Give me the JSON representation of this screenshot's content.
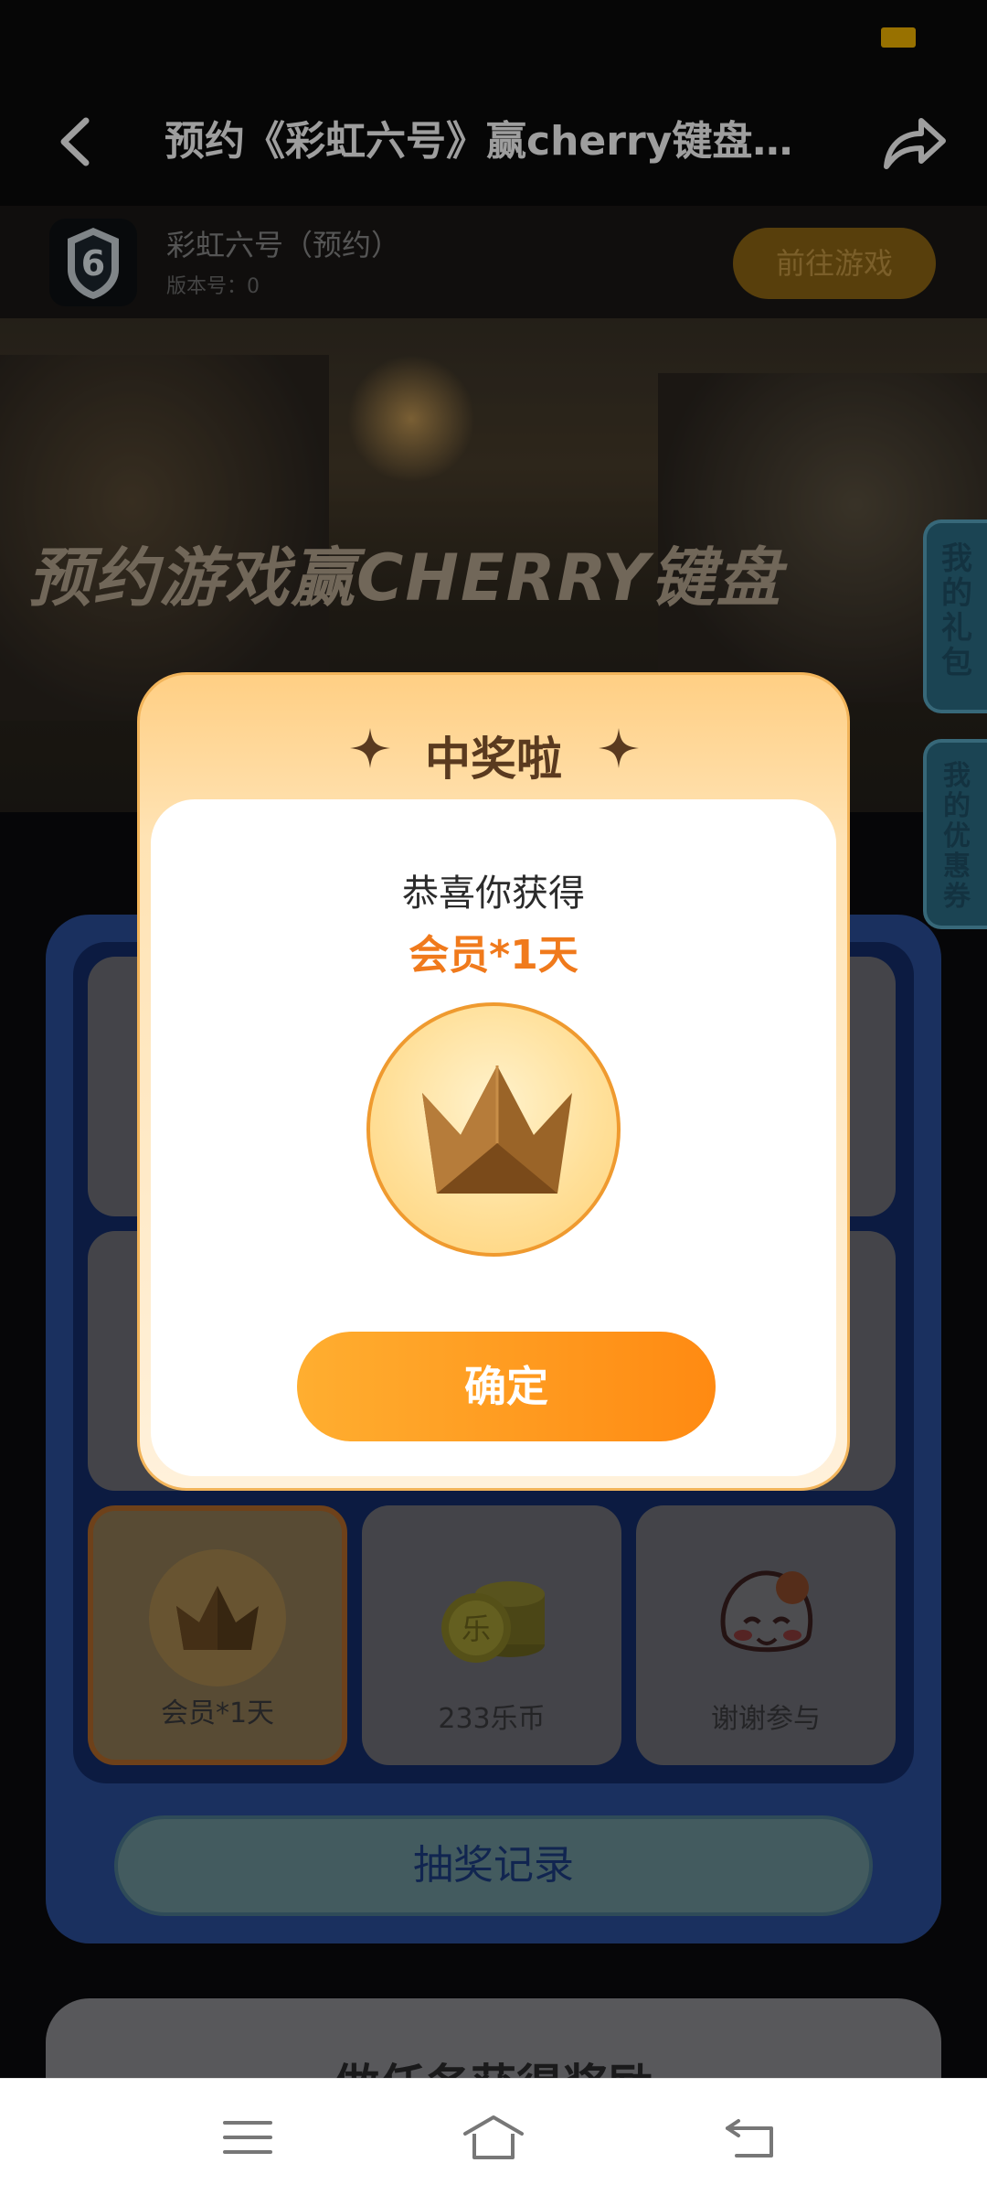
{
  "nav": {
    "title": "预约《彩虹六号》赢cherry键盘 ..."
  },
  "game": {
    "name": "彩虹六号（预约）",
    "version": "版本号：0",
    "goto_label": "前往游戏"
  },
  "banner": {
    "headline": "预约游戏赢CHERRY键盘"
  },
  "side_tabs": {
    "gift": "我的礼包",
    "coupon": "我的优惠券"
  },
  "lottery": {
    "cells": [
      {
        "label": "会员*1天",
        "icon": "crown-icon",
        "active": true
      },
      {
        "label": "233乐币",
        "icon": "coins-icon"
      },
      {
        "label": "谢谢参与",
        "icon": "mascot-icon"
      }
    ],
    "record_label": "抽奖记录"
  },
  "task": {
    "title": "做任务获得奖励"
  },
  "modal": {
    "title": "中奖啦",
    "congrats": "恭喜你获得",
    "prize": "会员*1天",
    "prize_icon": "crown-icon",
    "confirm_label": "确定"
  },
  "colors": {
    "accent_orange": "#ff8a12",
    "prize_text": "#f07a1c",
    "panel_blue": "#2a4e99"
  }
}
